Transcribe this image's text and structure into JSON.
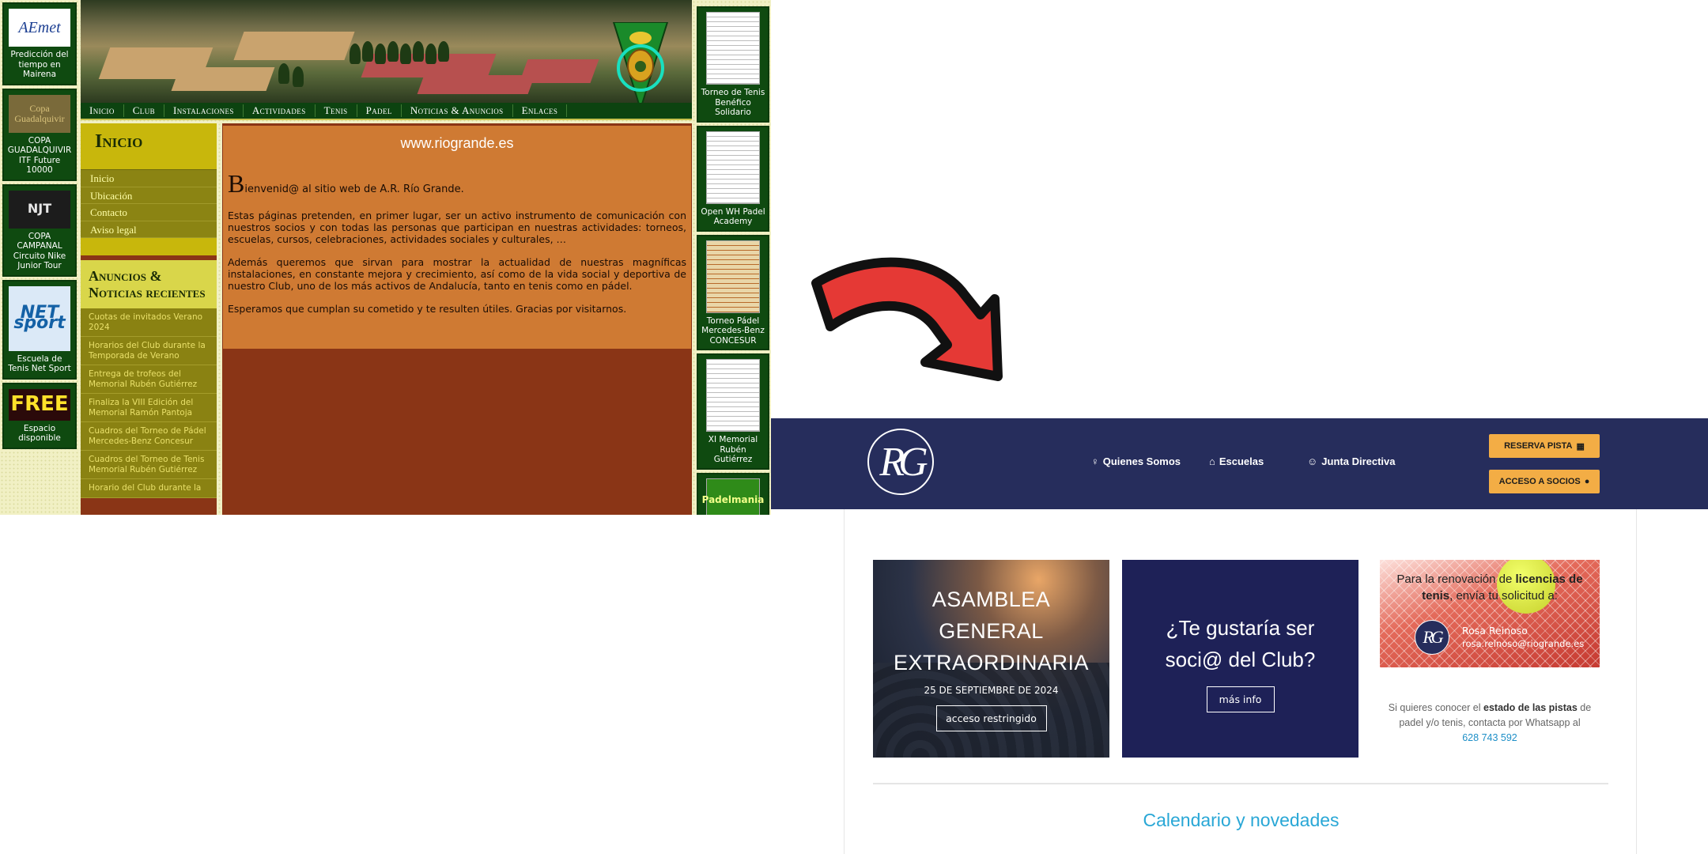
{
  "old_site": {
    "left_widgets": [
      {
        "thumb": "AEmet",
        "caption": "Predicción del tiempo en Mairena"
      },
      {
        "thumb": "Copa Guadalquivir",
        "caption": "COPA GUADALQUIVIR ITF Future 10000"
      },
      {
        "thumb": "NJT",
        "caption": "COPA CAMPANAL Circuito Nike Junior Tour"
      },
      {
        "thumb": "NET sport",
        "caption": "Escuela de Tenis Net Sport"
      },
      {
        "thumb": "FREE",
        "caption": "Espacio disponible"
      }
    ],
    "nav": [
      "Inicio",
      "Club",
      "Instalaciones",
      "Actividades",
      "Tenis",
      "Padel",
      "Noticias & Anuncios",
      "Enlaces"
    ],
    "sidebar": {
      "inicio_title": "Inicio",
      "inicio_links": [
        "Inicio",
        "Ubicación",
        "Contacto",
        "Aviso legal"
      ],
      "news_title": "Anuncios & Noticias recientes",
      "news_items": [
        "Cuotas de invitados Verano 2024",
        "Horarios del Club durante la Temporada de Verano",
        "Entrega de trofeos del Memorial Rubén Gutiérrez",
        "Finaliza la VIII Edición del Memorial Ramón Pantoja",
        "Cuadros del Torneo de Pádel Mercedes-Benz Concesur",
        "Cuadros del Torneo de Tenis Memorial Rubén Gutiérrez",
        "Horario del Club durante la"
      ]
    },
    "main": {
      "site": "www.riogrande.es",
      "welcome_drop": "B",
      "welcome_rest": "ienvenid@ al sitio web de A.R. Río Grande.",
      "p1": "Estas páginas pretenden, en primer lugar, ser un activo instrumento de comunicación con nuestros socios y con todas las personas que participan en nuestras actividades: torneos, escuelas, cursos, celebraciones, actividades sociales y culturales, …",
      "p2": "Además queremos que sirvan para mostrar la actualidad de nuestras magníficas instalaciones, en constante mejora y crecimiento, así como de la vida social y deportiva de nuestro Club, uno de los más activos de Andalucía, tanto en tenis como en pádel.",
      "p3": "Esperamos que cumplan su cometido y te resulten útiles. Gracias por visitarnos."
    },
    "right_widgets": [
      {
        "caption": "Torneo de Tenis Benéfico Solidario"
      },
      {
        "caption": "Open WH Padel Academy"
      },
      {
        "caption": "Torneo Pádel Mercedes-Benz CONCESUR"
      },
      {
        "caption": "XI Memorial Rubén Gutiérrez"
      },
      {
        "caption": "Padelmania"
      }
    ]
  },
  "new_site": {
    "logo": "RG",
    "nav": [
      {
        "icon": "user-icon",
        "label": "Quienes Somos"
      },
      {
        "icon": "home-icon",
        "label": "Escuelas"
      },
      {
        "icon": "user-circle-icon",
        "label": "Junta Directiva"
      }
    ],
    "reserva_label": "RESERVA PISTA",
    "acceso_label": "ACCESO A SOCIOS",
    "card_asamblea": {
      "title_lines": [
        "ASAMBLEA",
        "GENERAL",
        "EXTRAORDINARIA"
      ],
      "date": "25 DE SEPTIEMBRE DE 2024",
      "button": "acceso restringido"
    },
    "card_socio": {
      "title_lines": [
        "¿Te gustaría ser",
        "soci@ del Club?"
      ],
      "button": "más info"
    },
    "card_licencias": {
      "text_a": "Para la renovación de ",
      "text_b": "licencias de tenis",
      "text_c": ", envía tu solicitud a:",
      "name": "Rosa Reinoso",
      "email": "rosa.reinoso@riogrande.es"
    },
    "info": {
      "a": "Si quieres conocer el ",
      "b": "estado de las pistas",
      "c": " de padel y/o tenis, contacta por Whatsapp al",
      "phone": "628 743 592"
    },
    "section_title": "Calendario y novedades"
  },
  "colors": {
    "new_header": "#262d5c",
    "accent_yellow": "#f3ad45",
    "link_blue": "#29a7d6",
    "old_green": "#0f4a10",
    "arrow_red": "#e53935"
  }
}
